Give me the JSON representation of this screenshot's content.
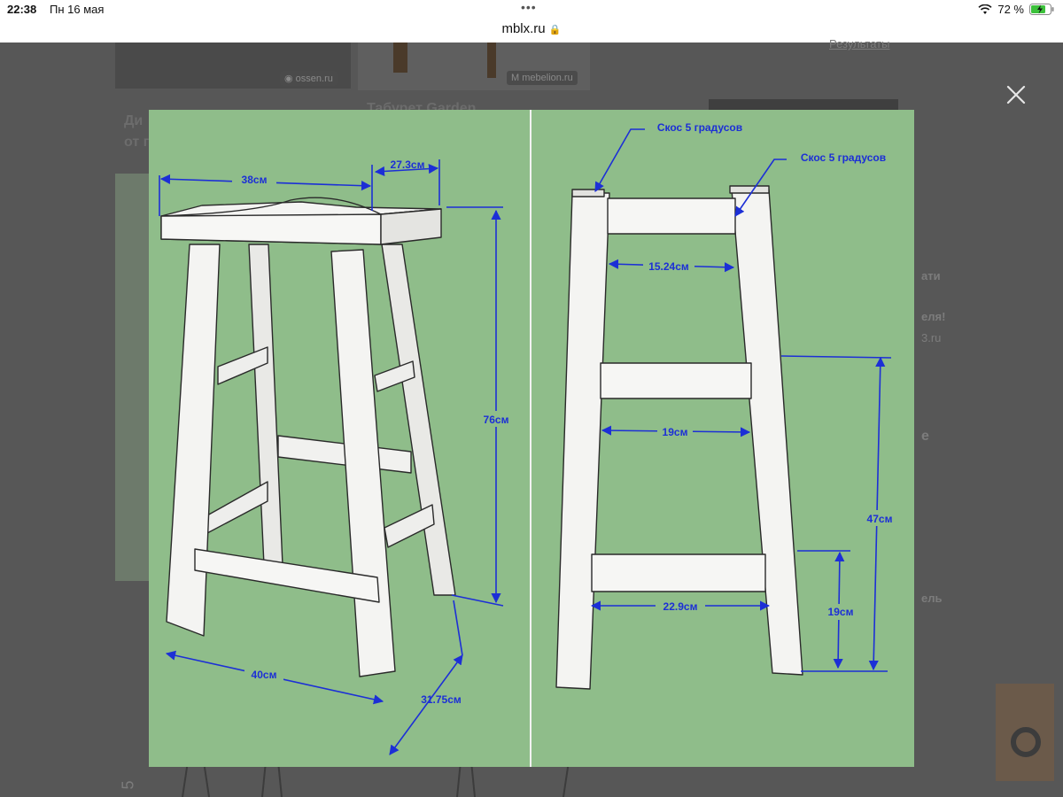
{
  "status_bar": {
    "time": "22:38",
    "date": "Пн 16 мая",
    "battery": "72 %"
  },
  "browser": {
    "url": "mblx.ru"
  },
  "background": {
    "source_left": "ossen.ru",
    "source_right": "mebelion.ru",
    "card_left_text_1": "Ди",
    "card_left_text_2": "от г",
    "card_mid_title": "Табурет Garden",
    "link_results": "Результаты",
    "side_1": "ати",
    "side_2": "еля!",
    "side_3": "3.ru",
    "side_4": "е",
    "side_5": "ель",
    "bottom_left": "5"
  },
  "diagram": {
    "left_view": {
      "seat_width": "38см",
      "seat_depth": "27.3см",
      "height": "76см",
      "base_width": "40см",
      "base_depth": "31.75см"
    },
    "right_view": {
      "bevel_left": "Скос 5 градусов",
      "bevel_right": "Скос 5 градусов",
      "top_rail": "15.24см",
      "middle_rail": "19см",
      "bottom_rail": "22.9см",
      "rail_height": "47см",
      "lower_rail_height": "19см"
    }
  },
  "colors": {
    "diagram_bg": "#8fbd8a",
    "dimension_blue": "#1c2fd6",
    "wood": "#f4f4f2"
  }
}
